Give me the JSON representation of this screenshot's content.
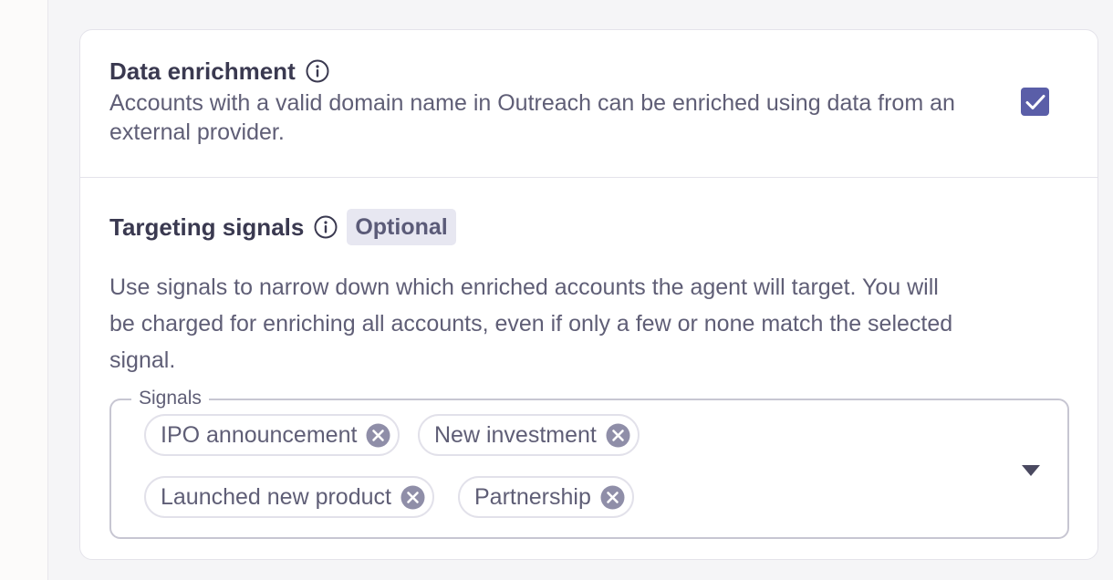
{
  "data_enrichment": {
    "title": "Data enrichment",
    "description_line1": "Accounts with a valid domain name in Outreach can be enriched using data from an",
    "description_line2": "external provider.",
    "checked": true
  },
  "targeting_signals": {
    "title": "Targeting signals",
    "badge": "Optional",
    "description_line1": "Use signals to narrow down which enriched accounts the agent will target. You will",
    "description_line2": "be charged for enriching all accounts, even if only a few or none match the selected",
    "description_line3": "signal.",
    "field_label": "Signals",
    "chips": [
      {
        "label": "IPO announcement"
      },
      {
        "label": "New investment"
      },
      {
        "label": "Launched new product"
      },
      {
        "label": "Partnership"
      }
    ]
  },
  "icons": {
    "info": "info-circle-icon",
    "check": "check-icon",
    "remove": "close-circle-icon",
    "dropdown": "caret-down-icon"
  },
  "colors": {
    "accent": "#5a5ea8",
    "title_text": "#3a3950",
    "body_text": "#5f5e76",
    "badge_bg": "#e7e7f1",
    "chip_remove": "#8f8ea8"
  }
}
